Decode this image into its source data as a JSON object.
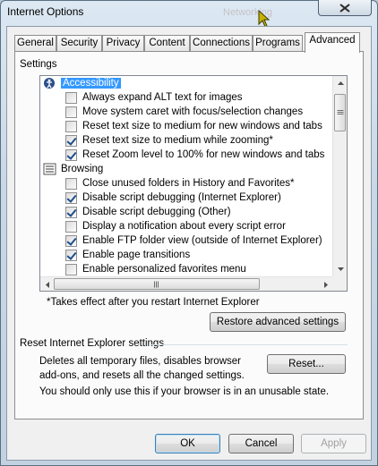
{
  "window": {
    "title": "Internet Options",
    "background_title": "Networking"
  },
  "tabs": [
    {
      "label": "General"
    },
    {
      "label": "Security"
    },
    {
      "label": "Privacy"
    },
    {
      "label": "Content"
    },
    {
      "label": "Connections"
    },
    {
      "label": "Programs"
    },
    {
      "label": "Advanced",
      "active": true
    }
  ],
  "settings": {
    "label": "Settings",
    "items": [
      {
        "type": "category",
        "icon": "accessibility-icon",
        "label": "Accessibility",
        "selected": true
      },
      {
        "type": "option",
        "label": "Always expand ALT text for images",
        "checked": false
      },
      {
        "type": "option",
        "label": "Move system caret with focus/selection changes",
        "checked": false
      },
      {
        "type": "option",
        "label": "Reset text size to medium for new windows and tabs",
        "checked": false
      },
      {
        "type": "option",
        "label": "Reset text size to medium while zooming*",
        "checked": true
      },
      {
        "type": "option",
        "label": "Reset Zoom level to 100% for new windows and tabs",
        "checked": true
      },
      {
        "type": "category",
        "icon": "browsing-icon",
        "label": "Browsing"
      },
      {
        "type": "option",
        "label": "Close unused folders in History and Favorites*",
        "checked": false
      },
      {
        "type": "option",
        "label": "Disable script debugging (Internet Explorer)",
        "checked": true
      },
      {
        "type": "option",
        "label": "Disable script debugging (Other)",
        "checked": true
      },
      {
        "type": "option",
        "label": "Display a notification about every script error",
        "checked": false
      },
      {
        "type": "option",
        "label": "Enable FTP folder view (outside of Internet Explorer)",
        "checked": true
      },
      {
        "type": "option",
        "label": "Enable page transitions",
        "checked": true
      },
      {
        "type": "option",
        "label": "Enable personalized favorites menu",
        "checked": false
      }
    ],
    "restart_note": "*Takes effect after you restart Internet Explorer",
    "restore_button": "Restore advanced settings"
  },
  "reset_group": {
    "title": "Reset Internet Explorer settings",
    "description_line1": "Deletes all temporary files, disables browser",
    "description_line2": "add-ons, and resets all the changed settings.",
    "reset_button": "Reset...",
    "warning": "You should only use this if your browser is in an unusable state."
  },
  "footer": {
    "ok": "OK",
    "cancel": "Cancel",
    "apply": "Apply",
    "apply_disabled": true
  },
  "colors": {
    "selection": "#3399ff",
    "checkmark": "#1f4e8a",
    "close_button_glyph": "#c0392b"
  }
}
